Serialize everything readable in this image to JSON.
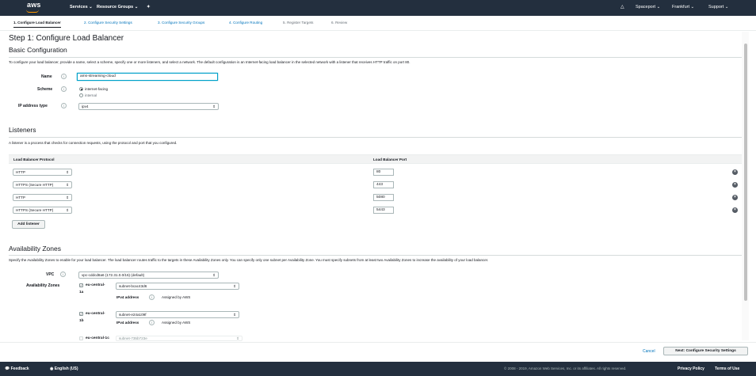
{
  "nav": {
    "logo": "aws",
    "services": "Services",
    "resource_groups": "Resource Groups",
    "pin": "✦",
    "bell": "🔔",
    "account": "Spaceport",
    "region": "Frankfurt",
    "support": "Support"
  },
  "steps": [
    {
      "label": "1. Configure Load Balancer"
    },
    {
      "label": "2. Configure Security Settings"
    },
    {
      "label": "3. Configure Security Groups"
    },
    {
      "label": "4. Configure Routing"
    },
    {
      "label": "5. Register Targets"
    },
    {
      "label": "6. Review"
    }
  ],
  "page": {
    "title": "Step 1: Configure Load Balancer"
  },
  "basic": {
    "heading": "Basic Configuration",
    "description": "To configure your load balancer, provide a name, select a scheme, specify one or more listeners, and select a network. The default configuration is an Internet-facing load balancer in the selected network with a listener that receives HTTP traffic on port 80.",
    "name_label": "Name",
    "name_value": "ams-streaming-cloud",
    "scheme_label": "Scheme",
    "scheme_options": [
      "internet-facing",
      "internal"
    ],
    "scheme_selected": "internet-facing",
    "ip_label": "IP address type",
    "ip_value": "ipv4"
  },
  "listeners": {
    "heading": "Listeners",
    "description": "A listener is a process that checks for connection requests, using the protocol and port that you configured.",
    "col_protocol": "Load Balancer Protocol",
    "col_port": "Load Balancer Port",
    "rows": [
      {
        "protocol": "HTTP",
        "port": "80"
      },
      {
        "protocol": "HTTPS (Secure HTTP)",
        "port": "443"
      },
      {
        "protocol": "HTTP",
        "port": "5080"
      },
      {
        "protocol": "HTTPS (Secure HTTP)",
        "port": "5443"
      }
    ],
    "add_button": "Add listener"
  },
  "az": {
    "heading": "Availability Zones",
    "description": "Specify the Availability Zones to enable for your load balancer. The load balancer routes traffic to the targets in these Availability Zones only. You can specify only one subnet per Availability Zone. You must specify subnets from at least two Availability Zones to increase the availability of your load balancer.",
    "vpc_label": "VPC",
    "vpc_value": "vpc-cddcd8a6 (172.31.0.0/16) (default)",
    "zones_label": "Availability Zones",
    "ipv4_label": "IPv4 address",
    "assigned": "Assigned by AWS",
    "zones": [
      {
        "name_line1": "eu-central-",
        "name_line2": "1a",
        "subnet": "subnet-bcac43d6",
        "checked": true
      },
      {
        "name_line1": "eu-central-",
        "name_line2": "1b",
        "subnet": "subnet-e24a109f",
        "checked": true
      },
      {
        "name_line1": "eu-central-1c",
        "name_line2": "",
        "subnet": "subnet-735b723e",
        "checked": false
      }
    ]
  },
  "actions": {
    "cancel": "Cancel",
    "next": "Next: Configure Security Settings"
  },
  "footer": {
    "feedback": "Feedback",
    "language": "English (US)",
    "copyright": "© 2008 - 2019, Amazon Web Services, Inc. or its affiliates. All rights reserved.",
    "privacy": "Privacy Policy",
    "terms": "Terms of Use"
  },
  "colors": {
    "nav_bg": "#232f3e",
    "link": "#0073bb",
    "accent": "#ff9900",
    "focus": "#00a1c9"
  }
}
